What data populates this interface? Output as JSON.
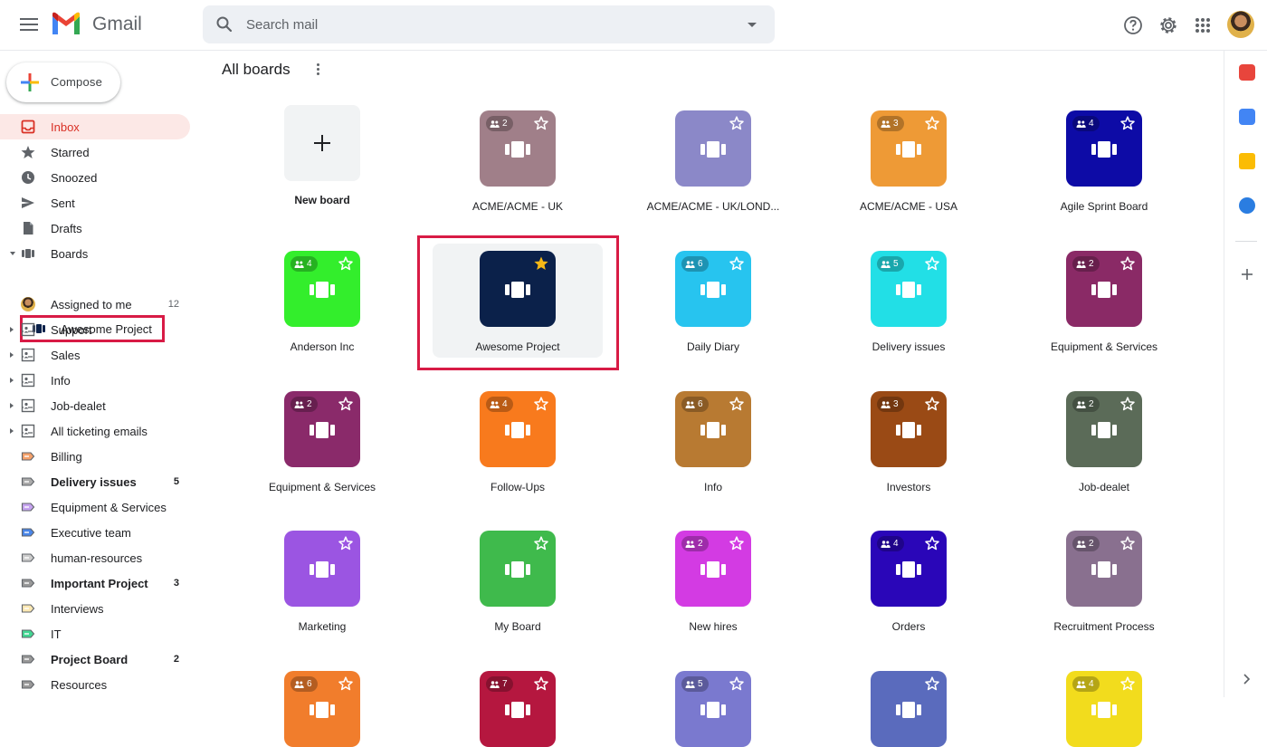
{
  "app": {
    "name": "Gmail",
    "search_placeholder": "Search mail"
  },
  "compose": {
    "label": "Compose"
  },
  "sidebar": {
    "items": [
      {
        "label": "Inbox",
        "icon": "inbox-icon",
        "active": true,
        "count": ""
      },
      {
        "label": "Starred",
        "icon": "star-icon",
        "count": ""
      },
      {
        "label": "Snoozed",
        "icon": "clock-icon",
        "count": ""
      },
      {
        "label": "Sent",
        "icon": "send-icon",
        "count": ""
      },
      {
        "label": "Drafts",
        "icon": "file-icon",
        "count": ""
      },
      {
        "label": "Boards",
        "icon": "board-icon",
        "count": "",
        "expanded": true
      },
      {
        "label": "Awesome Project",
        "icon": "board-icon",
        "count": "",
        "child": true
      },
      {
        "label": "Assigned to me",
        "icon": "avatar-icon",
        "count": "12"
      },
      {
        "label": "Support",
        "icon": "shared-inbox-icon",
        "count": "",
        "collapsed": true
      },
      {
        "label": "Sales",
        "icon": "shared-inbox-icon",
        "count": "",
        "collapsed": true
      },
      {
        "label": "Info",
        "icon": "shared-inbox-icon",
        "count": "",
        "collapsed": true
      },
      {
        "label": "Job-dealet",
        "icon": "shared-inbox-icon",
        "count": "",
        "collapsed": true
      },
      {
        "label": "All ticketing emails",
        "icon": "shared-inbox-icon",
        "count": "",
        "collapsed": true
      },
      {
        "label": "Billing",
        "icon": "label-icon",
        "color": "#f4a16b",
        "count": ""
      },
      {
        "label": "Delivery issues",
        "icon": "label-icon",
        "color": "#aaaaaa",
        "count": "5",
        "bold": true
      },
      {
        "label": "Equipment & Services",
        "icon": "label-icon",
        "color": "#c6a3f0",
        "count": ""
      },
      {
        "label": "Executive team",
        "icon": "label-icon",
        "color": "#4a86e8",
        "count": ""
      },
      {
        "label": "human-resources",
        "icon": "label-icon",
        "color": "#cccccc",
        "count": ""
      },
      {
        "label": "Important Project",
        "icon": "label-icon",
        "color": "#999999",
        "count": "3",
        "bold": true
      },
      {
        "label": "Interviews",
        "icon": "label-icon",
        "color": "#fce8b3",
        "count": ""
      },
      {
        "label": "IT",
        "icon": "label-icon",
        "color": "#43d692",
        "count": ""
      },
      {
        "label": "Project Board",
        "icon": "label-icon",
        "color": "#999999",
        "count": "2",
        "bold": true
      },
      {
        "label": "Resources",
        "icon": "label-icon",
        "color": "#999999",
        "count": ""
      }
    ]
  },
  "main": {
    "title": "All boards",
    "new_board_label": "New board",
    "boards": [
      {
        "label": "ACME/ACME - UK",
        "color": "#a07f89",
        "members": "2",
        "starred": false
      },
      {
        "label": "ACME/ACME - UK/LOND...",
        "color": "#8b88c8",
        "members": "",
        "starred": false
      },
      {
        "label": "ACME/ACME - USA",
        "color": "#ee9a36",
        "members": "3",
        "starred": false
      },
      {
        "label": "Agile Sprint Board",
        "color": "#0d0ba6",
        "members": "4",
        "starred": false
      },
      {
        "label": "Anderson Inc",
        "color": "#33ee2c",
        "members": "4",
        "starred": false
      },
      {
        "label": "Awesome Project",
        "color": "#0b214a",
        "members": "",
        "starred": true,
        "selected": true
      },
      {
        "label": "Daily Diary",
        "color": "#27c4ef",
        "members": "6",
        "starred": false
      },
      {
        "label": "Delivery issues",
        "color": "#22dfe6",
        "members": "5",
        "starred": false
      },
      {
        "label": "Equipment & Services",
        "color": "#8a2a66",
        "members": "2",
        "starred": false
      },
      {
        "label": "Equipment & Services",
        "color": "#8a2a6a",
        "members": "2",
        "starred": false
      },
      {
        "label": "Follow-Ups",
        "color": "#f87a1d",
        "members": "4",
        "starred": false
      },
      {
        "label": "Info",
        "color": "#b87a32",
        "members": "6",
        "starred": false
      },
      {
        "label": "Investors",
        "color": "#9a4a15",
        "members": "3",
        "starred": false
      },
      {
        "label": "Job-dealet",
        "color": "#5b6b58",
        "members": "2",
        "starred": false
      },
      {
        "label": "Marketing",
        "color": "#9b55e2",
        "members": "",
        "starred": false
      },
      {
        "label": "My Board",
        "color": "#3fba4c",
        "members": "",
        "starred": false
      },
      {
        "label": "New hires",
        "color": "#d33be3",
        "members": "2",
        "starred": false
      },
      {
        "label": "Orders",
        "color": "#2a06b8",
        "members": "4",
        "starred": false
      },
      {
        "label": "Recruitment Process",
        "color": "#89708f",
        "members": "2",
        "starred": false
      },
      {
        "label": "",
        "color": "#f17d2c",
        "members": "6",
        "starred": false
      },
      {
        "label": "",
        "color": "#b5173f",
        "members": "7",
        "starred": false
      },
      {
        "label": "",
        "color": "#7a79cf",
        "members": "5",
        "starred": false
      },
      {
        "label": "",
        "color": "#5a6bbd",
        "members": "",
        "starred": false
      },
      {
        "label": "",
        "color": "#f2dc1d",
        "members": "4",
        "starred": false
      }
    ]
  },
  "colors": {
    "accent": "#d93025",
    "highlight": "#d81b45",
    "star": "#f6b816"
  }
}
